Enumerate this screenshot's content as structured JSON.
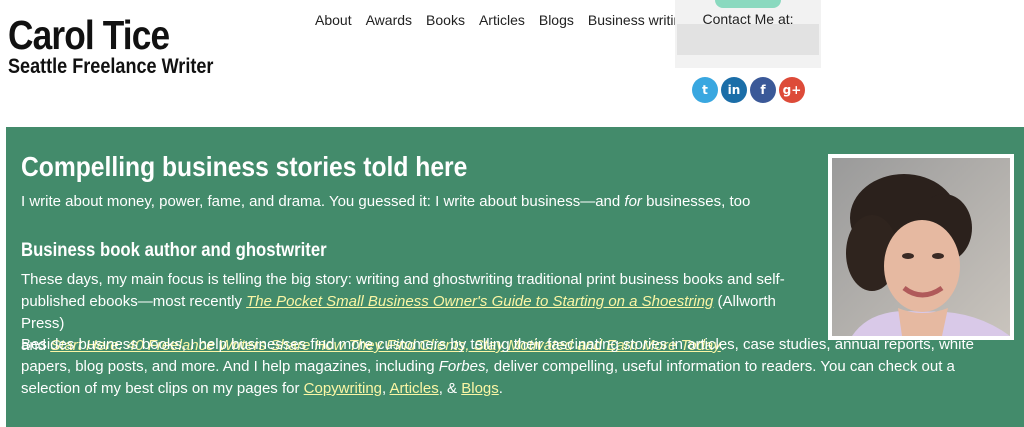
{
  "brand": {
    "name": "Carol Tice",
    "subtitle": "Seattle Freelance Writer"
  },
  "nav": {
    "items": [
      "About",
      "Awards",
      "Books",
      "Articles",
      "Blogs",
      "Business writing"
    ]
  },
  "contact": {
    "title": "Contact Me at:"
  },
  "social": [
    {
      "name": "twitter-icon",
      "glyph": "t",
      "color": "#39a7e0"
    },
    {
      "name": "linkedin-icon",
      "glyph": "in",
      "color": "#1b6ea8"
    },
    {
      "name": "facebook-icon",
      "glyph": "f",
      "color": "#3b5998"
    },
    {
      "name": "googleplus-icon",
      "glyph": "g+",
      "color": "#dd4b39"
    }
  ],
  "hero": {
    "bg_color": "#438b6b",
    "link_color": "#fbf6a5",
    "title": "Compelling business stories told here",
    "tagline_before": "I write about money, power, fame, and drama. You guessed it: I write about business—and ",
    "tagline_em": "for",
    "tagline_after": " businesses, too",
    "subtitle": "Business book author and ghostwriter",
    "p1_before": "These days, my main focus is telling the big story: writing and ghostwriting traditional print business books and self-published ebooks—most recently ",
    "p1_link1": "The Pocket Small Business Owner's Guide to Starting on a Shoestring",
    "p1_mid1": " (Allworth Press)",
    "p1_mid2": " and ",
    "p1_link2": "Start Here: 40 Freelance Writers Share How They Find Clients, Stay Motivated and Earn More Today",
    "p1_after": ".",
    "p2_before": "Besides business books, I help businesses find more customers by telling their fascinating stories in articles, case studies, annual reports, white papers, blog posts, and more. And I help magazines, including ",
    "p2_em": "Forbes,",
    "p2_mid": " deliver compelling, useful information to readers. You can check out a selection of my best clips on my pages for ",
    "p2_link1": "Copywriting",
    "p2_sep1": ", ",
    "p2_link2": "Articles",
    "p2_sep2": ", & ",
    "p2_link3": "Blogs",
    "p2_after": "."
  }
}
